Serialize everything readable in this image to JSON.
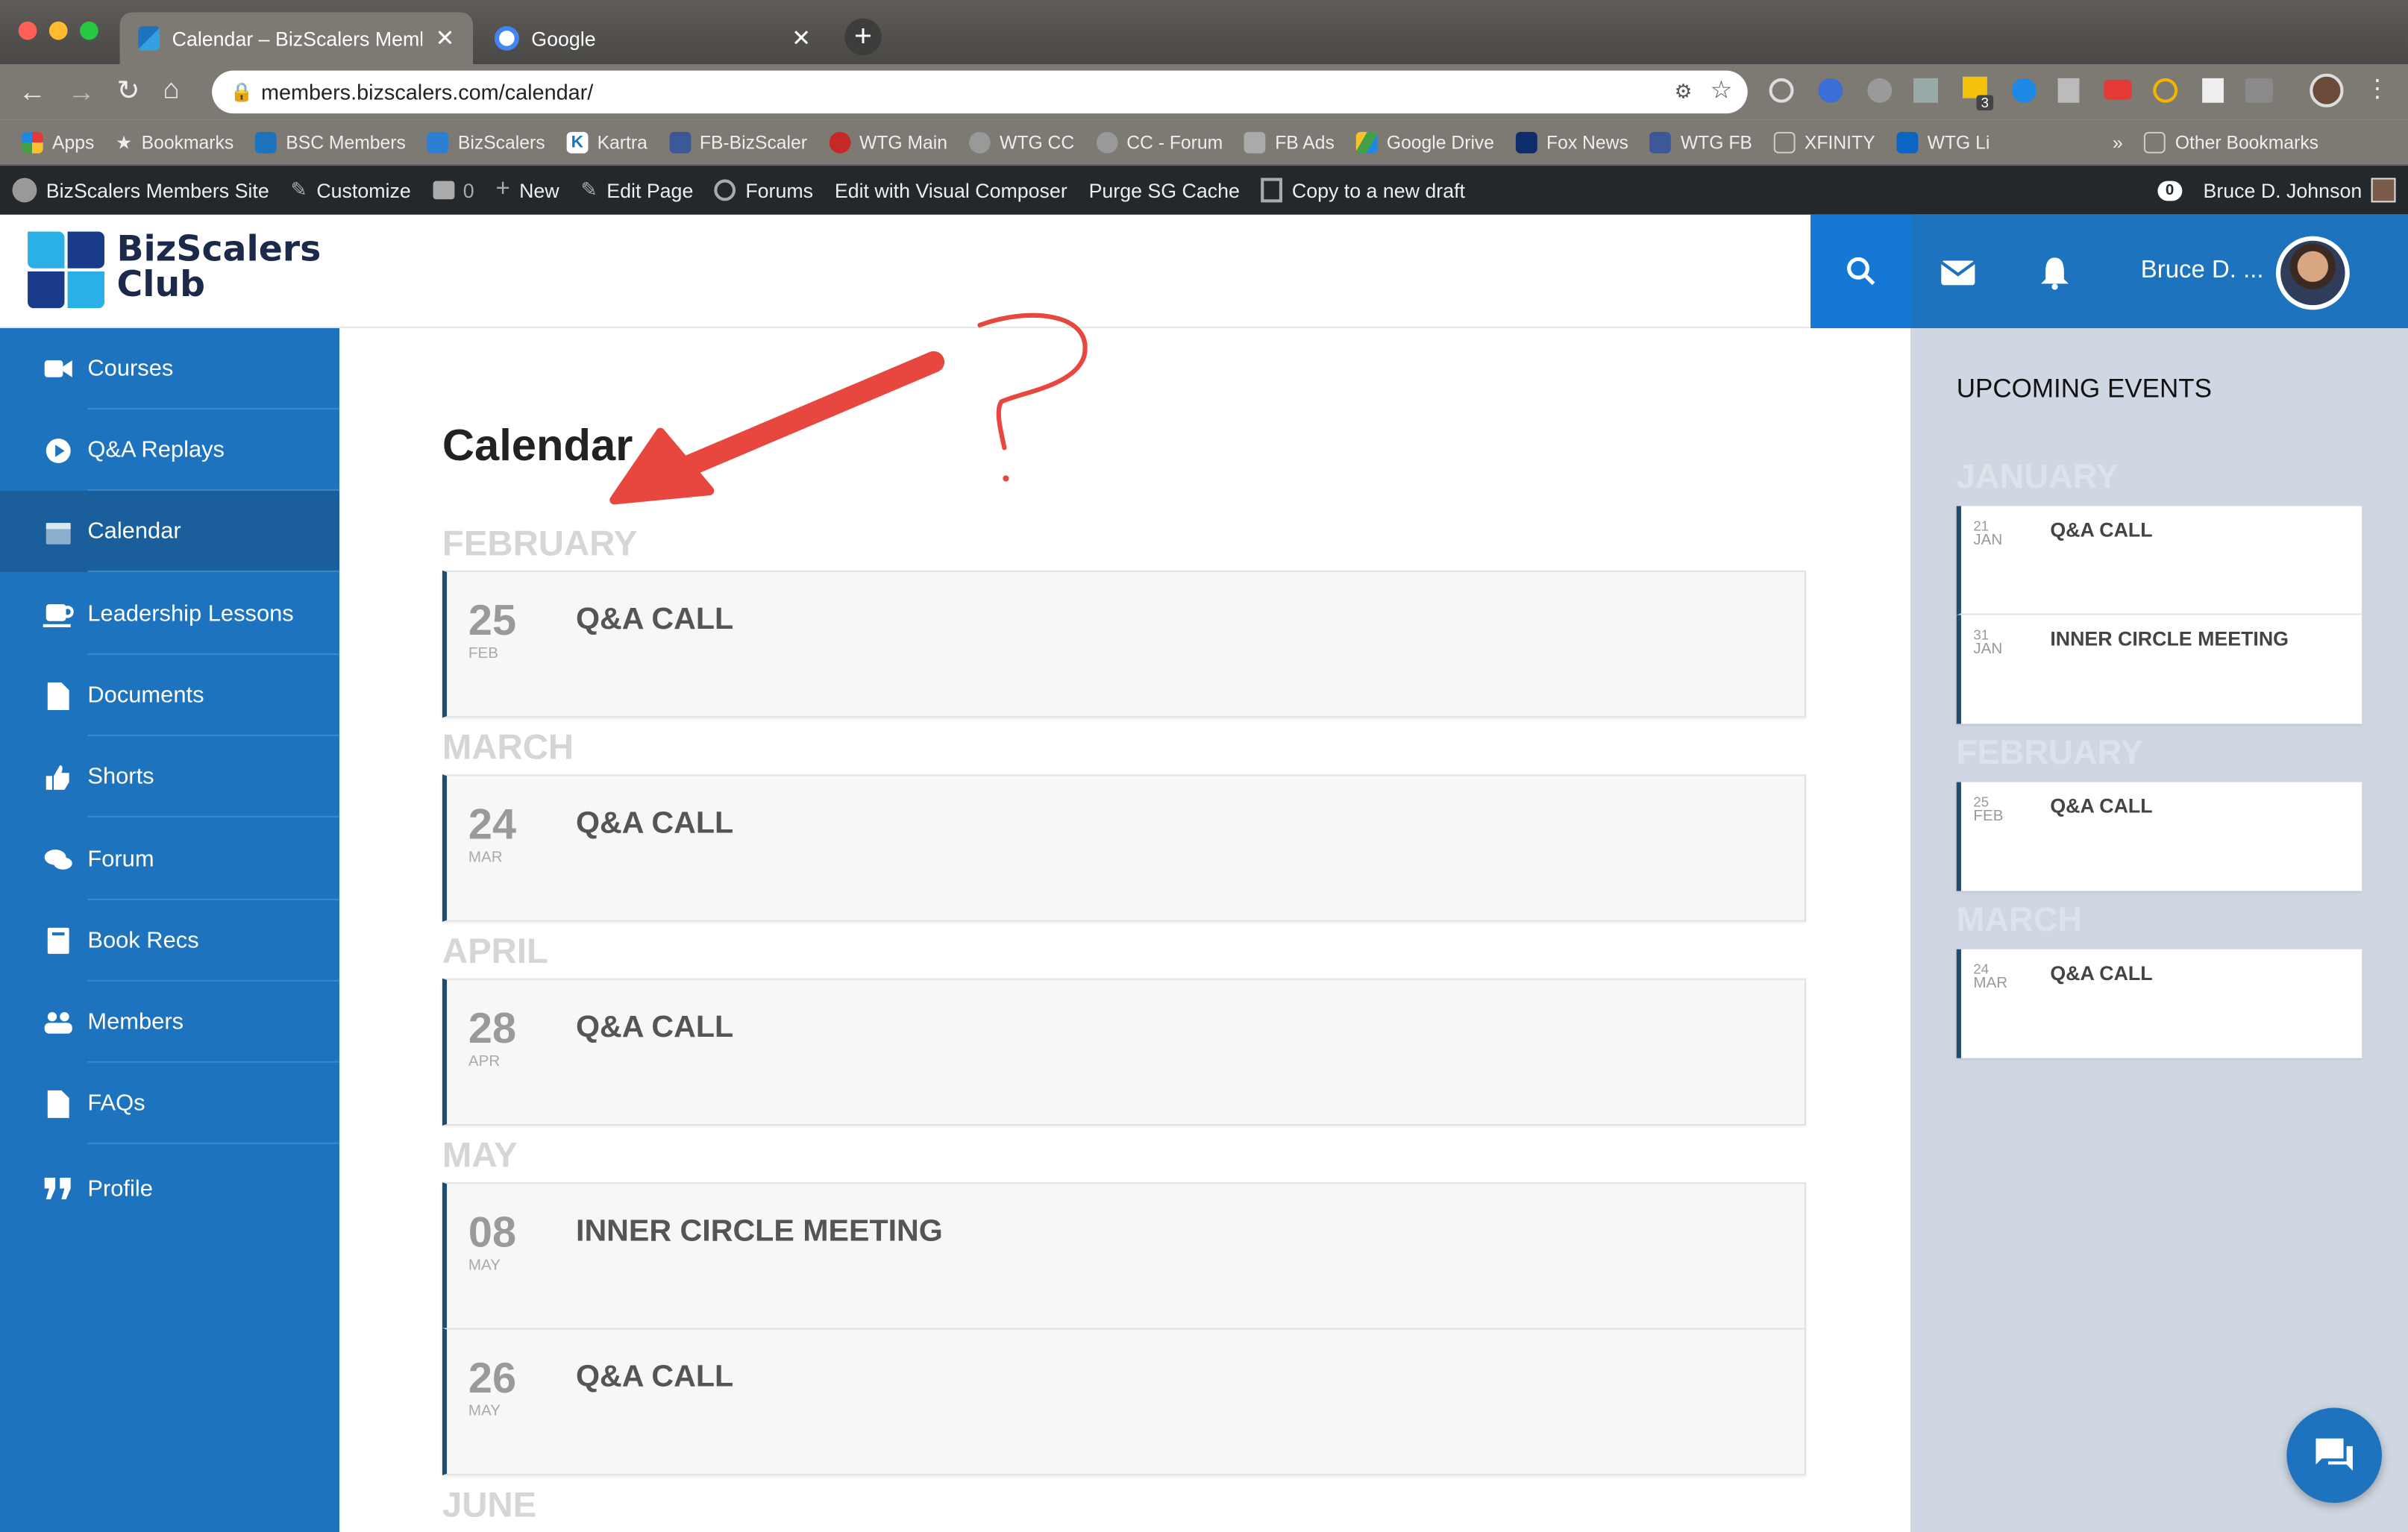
{
  "browser": {
    "tabs": [
      {
        "label": "Calendar – BizScalers Members",
        "close": "✕"
      },
      {
        "label": "Google",
        "close": "✕"
      }
    ],
    "new_tab": "+",
    "url": "members.bizscalers.com/calendar/",
    "bookmarks": [
      "Apps",
      "Bookmarks",
      "BSC Members",
      "BizScalers",
      "Kartra",
      "FB-BizScaler",
      "WTG Main",
      "WTG CC",
      "CC - Forum",
      "FB Ads",
      "Google Drive",
      "Fox News",
      "WTG FB",
      "XFINITY",
      "WTG Li"
    ],
    "bookmarks_more": "»",
    "other_bookmarks": "Other Bookmarks",
    "ext_badge": "3"
  },
  "admin_bar": {
    "site": "BizScalers Members Site",
    "customize": "Customize",
    "comments": "0",
    "new": "New",
    "edit_page": "Edit Page",
    "forums": "Forums",
    "visual_composer": "Edit with Visual Composer",
    "purge": "Purge SG Cache",
    "copy_draft": "Copy to a new draft",
    "notif_count": "0",
    "user": "Bruce D. Johnson"
  },
  "header": {
    "logo_line1": "BizScalers",
    "logo_line2": "Club",
    "user_short": "Bruce D. ..."
  },
  "sidebar": {
    "items": [
      {
        "label": "Courses",
        "icon": "video-icon"
      },
      {
        "label": "Q&A Replays",
        "icon": "play-icon"
      },
      {
        "label": "Calendar",
        "icon": "calendar-icon"
      },
      {
        "label": "Leadership Lessons",
        "icon": "coffee-icon"
      },
      {
        "label": "Documents",
        "icon": "document-icon"
      },
      {
        "label": "Shorts",
        "icon": "thumbs-up-icon"
      },
      {
        "label": "Forum",
        "icon": "comments-icon"
      },
      {
        "label": "Book Recs",
        "icon": "book-icon"
      },
      {
        "label": "Members",
        "icon": "users-icon"
      },
      {
        "label": "FAQs",
        "icon": "file-icon"
      },
      {
        "label": "Profile",
        "icon": "quote-icon"
      }
    ]
  },
  "main": {
    "title": "Calendar",
    "months": [
      {
        "name": "FEBRUARY",
        "events": [
          {
            "day": "25",
            "mon": "FEB",
            "title": "Q&A CALL"
          }
        ]
      },
      {
        "name": "MARCH",
        "events": [
          {
            "day": "24",
            "mon": "MAR",
            "title": "Q&A CALL"
          }
        ]
      },
      {
        "name": "APRIL",
        "events": [
          {
            "day": "28",
            "mon": "APR",
            "title": "Q&A CALL"
          }
        ]
      },
      {
        "name": "MAY",
        "events": [
          {
            "day": "08",
            "mon": "MAY",
            "title": "INNER CIRCLE MEETING"
          },
          {
            "day": "26",
            "mon": "MAY",
            "title": "Q&A CALL"
          }
        ]
      },
      {
        "name": "JUNE",
        "events": []
      }
    ]
  },
  "upcoming": {
    "title": "UPCOMING EVENTS",
    "months": [
      {
        "name": "JANUARY",
        "events": [
          {
            "day": "21",
            "mon": "JAN",
            "title": "Q&A CALL"
          },
          {
            "day": "31",
            "mon": "JAN",
            "title": "INNER CIRCLE MEETING"
          }
        ]
      },
      {
        "name": "FEBRUARY",
        "events": [
          {
            "day": "25",
            "mon": "FEB",
            "title": "Q&A CALL"
          }
        ]
      },
      {
        "name": "MARCH",
        "events": [
          {
            "day": "24",
            "mon": "MAR",
            "title": "Q&A CALL"
          }
        ]
      }
    ]
  },
  "colors": {
    "primary": "#1e73be",
    "active_nav": "#1a5e9c",
    "annotation": "#e8473f",
    "right_panel": "#cfd7e2"
  }
}
